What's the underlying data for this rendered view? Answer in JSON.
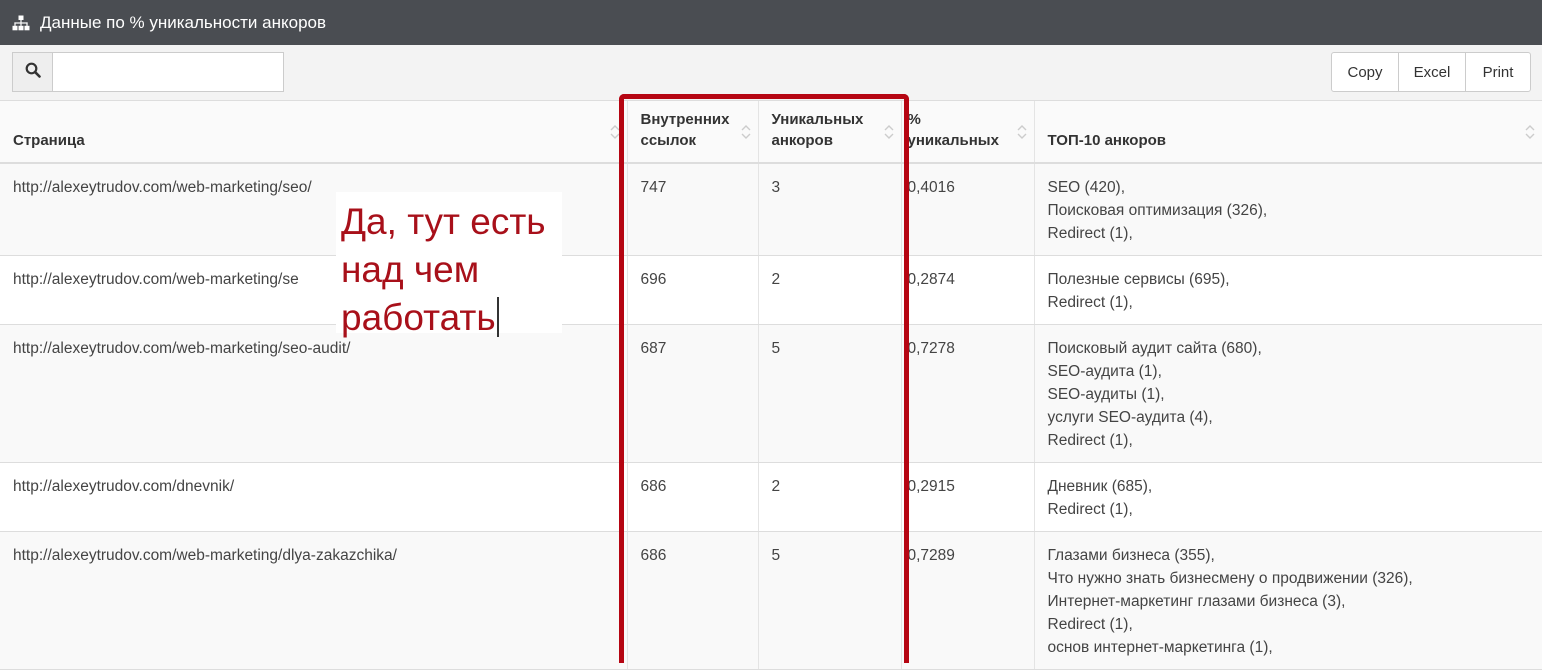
{
  "panel": {
    "title": "Данные по % уникальности анкоров",
    "icon": "sitemap-icon"
  },
  "search": {
    "value": "",
    "placeholder": "",
    "icon": "search-icon"
  },
  "buttons": [
    "Copy",
    "Excel",
    "Print"
  ],
  "table": {
    "columns": [
      "Страница",
      "Внутренних ссылок",
      "Уникальных анкоров",
      "% уникальных",
      "ТОП-10 анкоров"
    ],
    "rows": [
      {
        "page": "http://alexeytrudov.com/web-marketing/seo/",
        "internal_links": "747",
        "unique_anchors": "3",
        "unique_pct": "0,4016",
        "top_anchors": [
          "SEO (420),",
          "Поисковая оптимизация (326),",
          "Redirect (1),"
        ]
      },
      {
        "page": "http://alexeytrudov.com/web-marketing/se",
        "internal_links": "696",
        "unique_anchors": "2",
        "unique_pct": "0,2874",
        "top_anchors": [
          "Полезные сервисы (695),",
          "Redirect (1),"
        ]
      },
      {
        "page": "http://alexeytrudov.com/web-marketing/seo-audit/",
        "internal_links": "687",
        "unique_anchors": "5",
        "unique_pct": "0,7278",
        "top_anchors": [
          "Поисковый аудит сайта (680),",
          "SEO-аудита (1),",
          "SEO-аудиты (1),",
          "услуги SEO-аудита (4),",
          "Redirect (1),"
        ]
      },
      {
        "page": "http://alexeytrudov.com/dnevnik/",
        "internal_links": "686",
        "unique_anchors": "2",
        "unique_pct": "0,2915",
        "top_anchors": [
          "Дневник (685),",
          "Redirect (1),"
        ]
      },
      {
        "page": "http://alexeytrudov.com/web-marketing/dlya-zakazchika/",
        "internal_links": "686",
        "unique_anchors": "5",
        "unique_pct": "0,7289",
        "top_anchors": [
          "Глазами бизнеса (355),",
          "Что нужно знать бизнесмену о продвижении (326),",
          "Интернет-маркетинг глазами бизнеса (3),",
          "Redirect (1),",
          "основ интернет-маркетинга (1),"
        ]
      }
    ]
  },
  "annotation": {
    "lines": [
      "Да, тут есть",
      "над чем",
      "работать"
    ],
    "color": "#a8101a",
    "highlight_color": "#b50512"
  }
}
